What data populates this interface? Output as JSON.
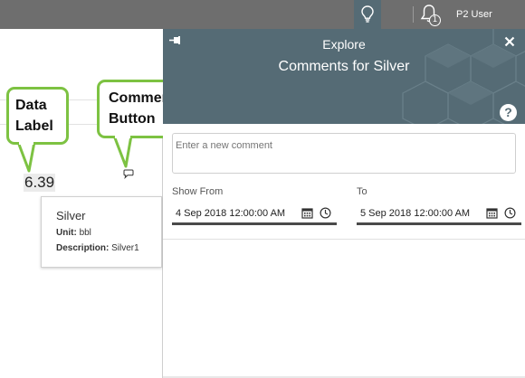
{
  "topbar": {
    "user_name": "P2 User",
    "notification_count": "1"
  },
  "callouts": {
    "data_label": "Data Label",
    "comments_button": "Comments Button"
  },
  "data": {
    "value": "6.39"
  },
  "tooltip": {
    "title": "Silver",
    "unit_label": "Unit:",
    "unit_value": "bbl",
    "description_label": "Description:",
    "description_value": "Silver1"
  },
  "panel": {
    "header_label": "Explore",
    "title": "Comments for Silver",
    "help_symbol": "?",
    "new_comment_placeholder": "Enter a new comment",
    "show_from_label": "Show From",
    "to_label": "To",
    "show_from_value": "4 Sep 2018 12:00:00 AM",
    "to_value": "5 Sep 2018 12:00:00 AM"
  },
  "colors": {
    "topbar": "#6e6e6e",
    "panel_header": "#556b75",
    "callout_border": "#7dc242"
  },
  "icons": [
    "lightbulb-icon",
    "bell-icon",
    "pin-icon",
    "close-icon",
    "help-icon",
    "comment-icon",
    "calendar-icon",
    "clock-icon"
  ]
}
